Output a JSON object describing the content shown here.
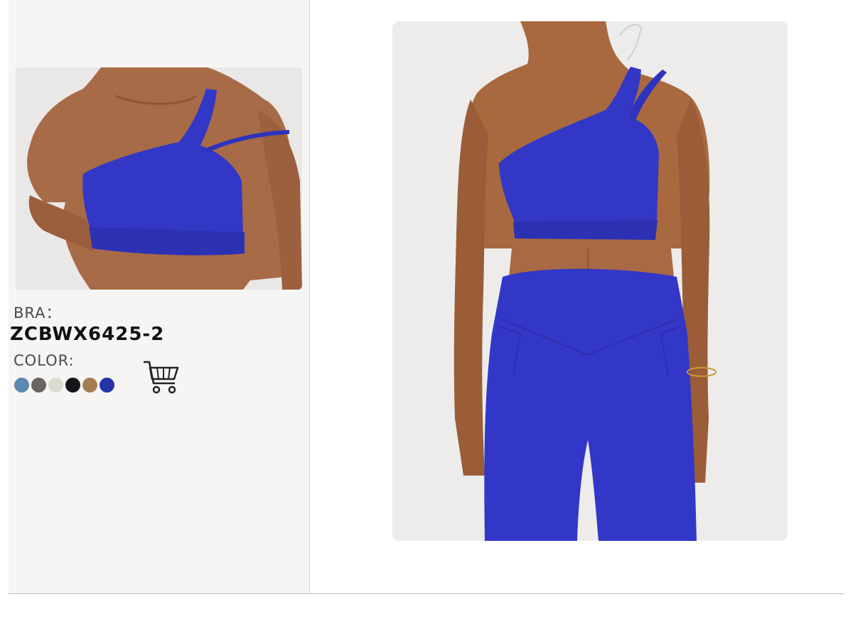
{
  "product": {
    "bra_label": "BRA：",
    "sku": "ZCBWX6425-2",
    "color_label": "COLOR:"
  },
  "swatches": [
    {
      "name": "blue-grey",
      "hex": "#5b87b0"
    },
    {
      "name": "charcoal",
      "hex": "#6a6560"
    },
    {
      "name": "cream",
      "hex": "#dcdccf"
    },
    {
      "name": "black",
      "hex": "#16161a"
    },
    {
      "name": "camel",
      "hex": "#a67c52"
    },
    {
      "name": "royal-blue",
      "hex": "#2532a8"
    }
  ],
  "icons": {
    "cart": "shopping-cart-icon"
  },
  "colors": {
    "garment": "#3136c4",
    "skin": "#a86a45",
    "background": "#ecebea"
  }
}
